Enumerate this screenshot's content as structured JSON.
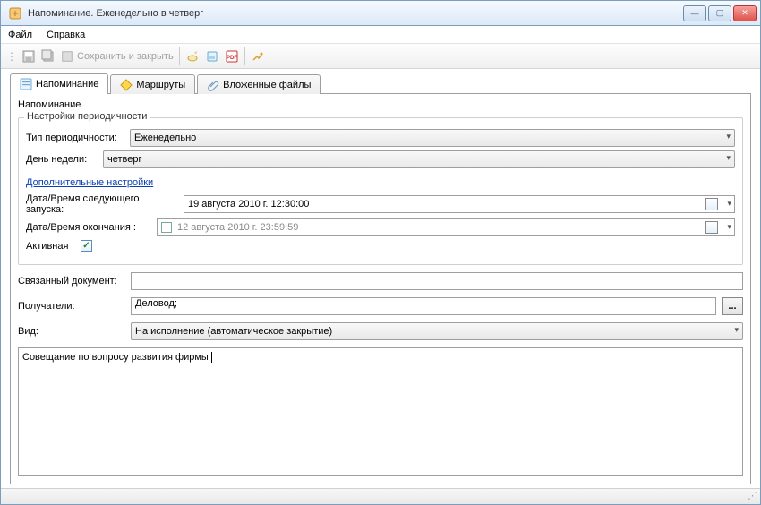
{
  "window": {
    "title": "Напоминание. Еженедельно в четверг"
  },
  "menu": {
    "file": "Файл",
    "help": "Справка"
  },
  "toolbar": {
    "save_close": "Сохранить и закрыть"
  },
  "tabs": {
    "reminder": "Напоминание",
    "routes": "Маршруты",
    "attachments": "Вложенные файлы"
  },
  "sections": {
    "reminder_header": "Напоминание",
    "periodicity_group": "Настройки периодичности",
    "type_label": "Тип периодичности:",
    "type_value": "Еженедельно",
    "day_label": "День недели:",
    "day_value": "четверг",
    "advanced_link": "Дополнительные настройки",
    "next_run_label": "Дата/Время следующего запуска:",
    "next_run_value": "19  августа  2010 г. 12:30:00",
    "end_label": "Дата/Время окончания :",
    "end_value": "12  августа  2010 г. 23:59:59",
    "active_label": "Активная",
    "linked_doc_label": "Связанный документ:",
    "linked_doc_value": "",
    "recipients_label": "Получатели:",
    "recipients_value": "Деловод;",
    "kind_label": "Вид:",
    "kind_value": "На исполнение (автоматическое закрытие)",
    "memo_text": "Совещание по вопросу развития фирмы"
  }
}
